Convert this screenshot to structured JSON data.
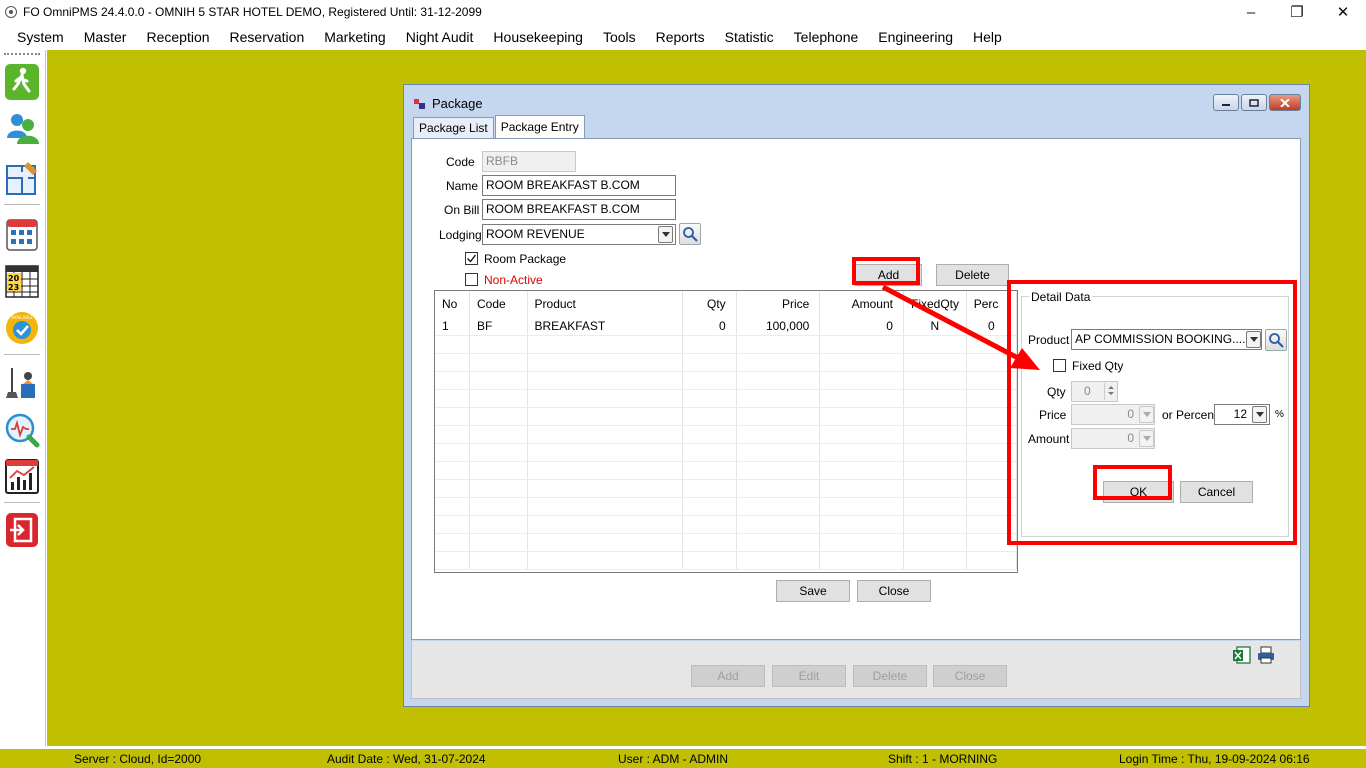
{
  "app": {
    "title": "FO OmniPMS 24.4.0.0 - OMNIH 5 STAR HOTEL DEMO, Registered Until: 31-12-2099",
    "window_buttons": {
      "minimize": "–",
      "restore": "❐",
      "close": "✕"
    }
  },
  "menu": [
    "System",
    "Master",
    "Reception",
    "Reservation",
    "Marketing",
    "Night Audit",
    "Housekeeping",
    "Tools",
    "Reports",
    "Statistic",
    "Telephone",
    "Engineering",
    "Help"
  ],
  "toolbar_icons": [
    "walk-in-icon",
    "guests-icon",
    "floor-plan-icon",
    "calendar-grid-icon",
    "calendar-2023-icon",
    "availability-badge-icon",
    "housekeeping-icon",
    "analysis-search-icon",
    "statistics-chart-icon",
    "exit-icon"
  ],
  "toolbar_badge_text": "AVAILABLE",
  "package_window": {
    "title": "Package",
    "tabs": [
      "Package List",
      "Package Entry"
    ],
    "form": {
      "code_label": "Code",
      "code_value": "RBFB",
      "name_label": "Name",
      "name_value": "ROOM BREAKFAST B.COM",
      "onbill_label": "On Bill",
      "onbill_value": "ROOM BREAKFAST B.COM",
      "lodging_label": "Lodging",
      "lodging_value": "ROOM REVENUE",
      "room_package_label": "Room Package",
      "room_package_checked": true,
      "non_active_label": "Non-Active",
      "non_active_checked": false
    },
    "grid_buttons": {
      "add": "Add",
      "delete": "Delete"
    },
    "grid": {
      "columns": [
        "No",
        "Code",
        "Product",
        "Qty",
        "Price",
        "Amount",
        "FixedQty",
        "Perc"
      ],
      "rows": [
        {
          "no": "1",
          "code": "BF",
          "product": "BREAKFAST",
          "qty": "0",
          "price": "100,000",
          "amount": "0",
          "fixed": "N",
          "perc": "0"
        }
      ]
    },
    "detail": {
      "legend": "Detail Data",
      "product_label": "Product",
      "product_value": "AP COMMISSION BOOKING....",
      "fixed_qty_label": "Fixed Qty",
      "fixed_qty_checked": false,
      "qty_label": "Qty",
      "qty_value": "0",
      "price_label": "Price",
      "price_value": "0",
      "or_percent_label": "or Percent",
      "percent_value": "12",
      "percent_suffix": "%",
      "amount_label": "Amount",
      "amount_value": "0",
      "ok": "OK",
      "cancel": "Cancel"
    },
    "form_buttons": {
      "save": "Save",
      "close": "Close"
    },
    "bottom_buttons": {
      "add": "Add",
      "edit": "Edit",
      "delete": "Delete",
      "close": "Close"
    }
  },
  "status": {
    "server": "Server : Cloud, Id=2000",
    "audit_date": "Audit Date : Wed, 31-07-2024",
    "user": "User : ADM - ADMIN",
    "shift": "Shift : 1 - MORNING",
    "login_time": "Login Time : Thu, 19-09-2024 06:16"
  },
  "colors": {
    "workspace": "#c1bf02",
    "window_frame": "#c4d7ee",
    "highlight": "#ff0000",
    "non_active_text": "#e00000"
  }
}
